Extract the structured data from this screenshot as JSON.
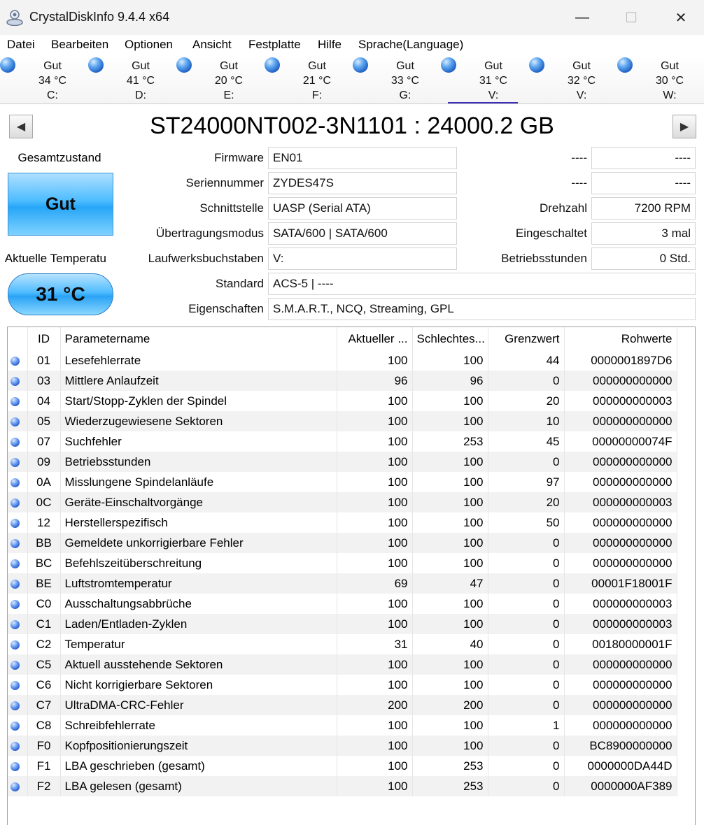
{
  "window": {
    "title": "CrystalDiskInfo 9.4.4 x64",
    "minimize_glyph": "—",
    "maximize_glyph": "☐",
    "close_glyph": "✕"
  },
  "menu": [
    "Datei",
    "Bearbeiten",
    "Optionen",
    "Ansicht",
    "Festplatte",
    "Hilfe",
    "Sprache(Language)"
  ],
  "drives": [
    {
      "status": "Gut",
      "temp": "34 °C",
      "letter": "C:"
    },
    {
      "status": "Gut",
      "temp": "41 °C",
      "letter": "D:"
    },
    {
      "status": "Gut",
      "temp": "20 °C",
      "letter": "E:"
    },
    {
      "status": "Gut",
      "temp": "21 °C",
      "letter": "F:"
    },
    {
      "status": "Gut",
      "temp": "33 °C",
      "letter": "G:"
    },
    {
      "status": "Gut",
      "temp": "31 °C",
      "letter": "V:",
      "active": true
    },
    {
      "status": "Gut",
      "temp": "32 °C",
      "letter": "V:"
    },
    {
      "status": "Gut",
      "temp": "30 °C",
      "letter": "W:"
    }
  ],
  "disk": {
    "title": "ST24000NT002-3N1101 : 24000.2 GB",
    "prev_glyph": "◀",
    "next_glyph": "▶",
    "health_label": "Gesamtzustand",
    "health_value": "Gut",
    "temp_label": "Aktuelle Temperatu",
    "temp_value": "31 °C",
    "firmware_label": "Firmware",
    "firmware": "EN01",
    "serial_label": "Seriennummer",
    "serial": "ZYDES47S",
    "interface_label": "Schnittstelle",
    "interface": "UASP (Serial ATA)",
    "transfer_label": "Übertragungsmodus",
    "transfer": "SATA/600 | SATA/600",
    "letters_label": "Laufwerksbuchstaben",
    "letters": "V:",
    "standard_label": "Standard",
    "standard": "ACS-5 | ----",
    "features_label": "Eigenschaften",
    "features": "S.M.A.R.T., NCQ, Streaming, GPL",
    "right1_label": "----",
    "right1_value": "----",
    "right2_label": "----",
    "right2_value": "----",
    "rpm_label": "Drehzahl",
    "rpm": "7200 RPM",
    "power_on_count_label": "Eingeschaltet",
    "power_on_count": "3 mal",
    "power_on_hours_label": "Betriebsstunden",
    "power_on_hours": "0 Std."
  },
  "smart": {
    "headers": [
      "ID",
      "Parametername",
      "Aktueller ...",
      "Schlechtes...",
      "Grenzwert",
      "Rohwerte"
    ],
    "rows": [
      {
        "id": "01",
        "name": "Lesefehlerrate",
        "current": "100",
        "worst": "100",
        "threshold": "44",
        "raw": "0000001897D6"
      },
      {
        "id": "03",
        "name": "Mittlere Anlaufzeit",
        "current": "96",
        "worst": "96",
        "threshold": "0",
        "raw": "000000000000"
      },
      {
        "id": "04",
        "name": "Start/Stopp-Zyklen der Spindel",
        "current": "100",
        "worst": "100",
        "threshold": "20",
        "raw": "000000000003"
      },
      {
        "id": "05",
        "name": "Wiederzugewiesene Sektoren",
        "current": "100",
        "worst": "100",
        "threshold": "10",
        "raw": "000000000000"
      },
      {
        "id": "07",
        "name": "Suchfehler",
        "current": "100",
        "worst": "253",
        "threshold": "45",
        "raw": "00000000074F"
      },
      {
        "id": "09",
        "name": "Betriebsstunden",
        "current": "100",
        "worst": "100",
        "threshold": "0",
        "raw": "000000000000"
      },
      {
        "id": "0A",
        "name": "Misslungene Spindelanläufe",
        "current": "100",
        "worst": "100",
        "threshold": "97",
        "raw": "000000000000"
      },
      {
        "id": "0C",
        "name": "Geräte-Einschaltvorgänge",
        "current": "100",
        "worst": "100",
        "threshold": "20",
        "raw": "000000000003"
      },
      {
        "id": "12",
        "name": "Herstellerspezifisch",
        "current": "100",
        "worst": "100",
        "threshold": "50",
        "raw": "000000000000"
      },
      {
        "id": "BB",
        "name": "Gemeldete unkorrigierbare Fehler",
        "current": "100",
        "worst": "100",
        "threshold": "0",
        "raw": "000000000000"
      },
      {
        "id": "BC",
        "name": "Befehlszeitüberschreitung",
        "current": "100",
        "worst": "100",
        "threshold": "0",
        "raw": "000000000000"
      },
      {
        "id": "BE",
        "name": "Luftstromtemperatur",
        "current": "69",
        "worst": "47",
        "threshold": "0",
        "raw": "00001F18001F"
      },
      {
        "id": "C0",
        "name": "Ausschaltungsabbrüche",
        "current": "100",
        "worst": "100",
        "threshold": "0",
        "raw": "000000000003"
      },
      {
        "id": "C1",
        "name": "Laden/Entladen-Zyklen",
        "current": "100",
        "worst": "100",
        "threshold": "0",
        "raw": "000000000003"
      },
      {
        "id": "C2",
        "name": "Temperatur",
        "current": "31",
        "worst": "40",
        "threshold": "0",
        "raw": "00180000001F"
      },
      {
        "id": "C5",
        "name": "Aktuell ausstehende Sektoren",
        "current": "100",
        "worst": "100",
        "threshold": "0",
        "raw": "000000000000"
      },
      {
        "id": "C6",
        "name": "Nicht korrigierbare Sektoren",
        "current": "100",
        "worst": "100",
        "threshold": "0",
        "raw": "000000000000"
      },
      {
        "id": "C7",
        "name": "UltraDMA-CRC-Fehler",
        "current": "200",
        "worst": "200",
        "threshold": "0",
        "raw": "000000000000"
      },
      {
        "id": "C8",
        "name": "Schreibfehlerrate",
        "current": "100",
        "worst": "100",
        "threshold": "1",
        "raw": "000000000000"
      },
      {
        "id": "F0",
        "name": "Kopfpositionierungszeit",
        "current": "100",
        "worst": "100",
        "threshold": "0",
        "raw": "BC8900000000"
      },
      {
        "id": "F1",
        "name": "LBA geschrieben (gesamt)",
        "current": "100",
        "worst": "253",
        "threshold": "0",
        "raw": "0000000DA44D"
      },
      {
        "id": "F2",
        "name": "LBA gelesen (gesamt)",
        "current": "100",
        "worst": "253",
        "threshold": "0",
        "raw": "0000000AF389"
      }
    ]
  },
  "icons": {
    "app": "crystaldiskinfo-app-icon",
    "status_dot": "blue-status-ball-icon"
  }
}
